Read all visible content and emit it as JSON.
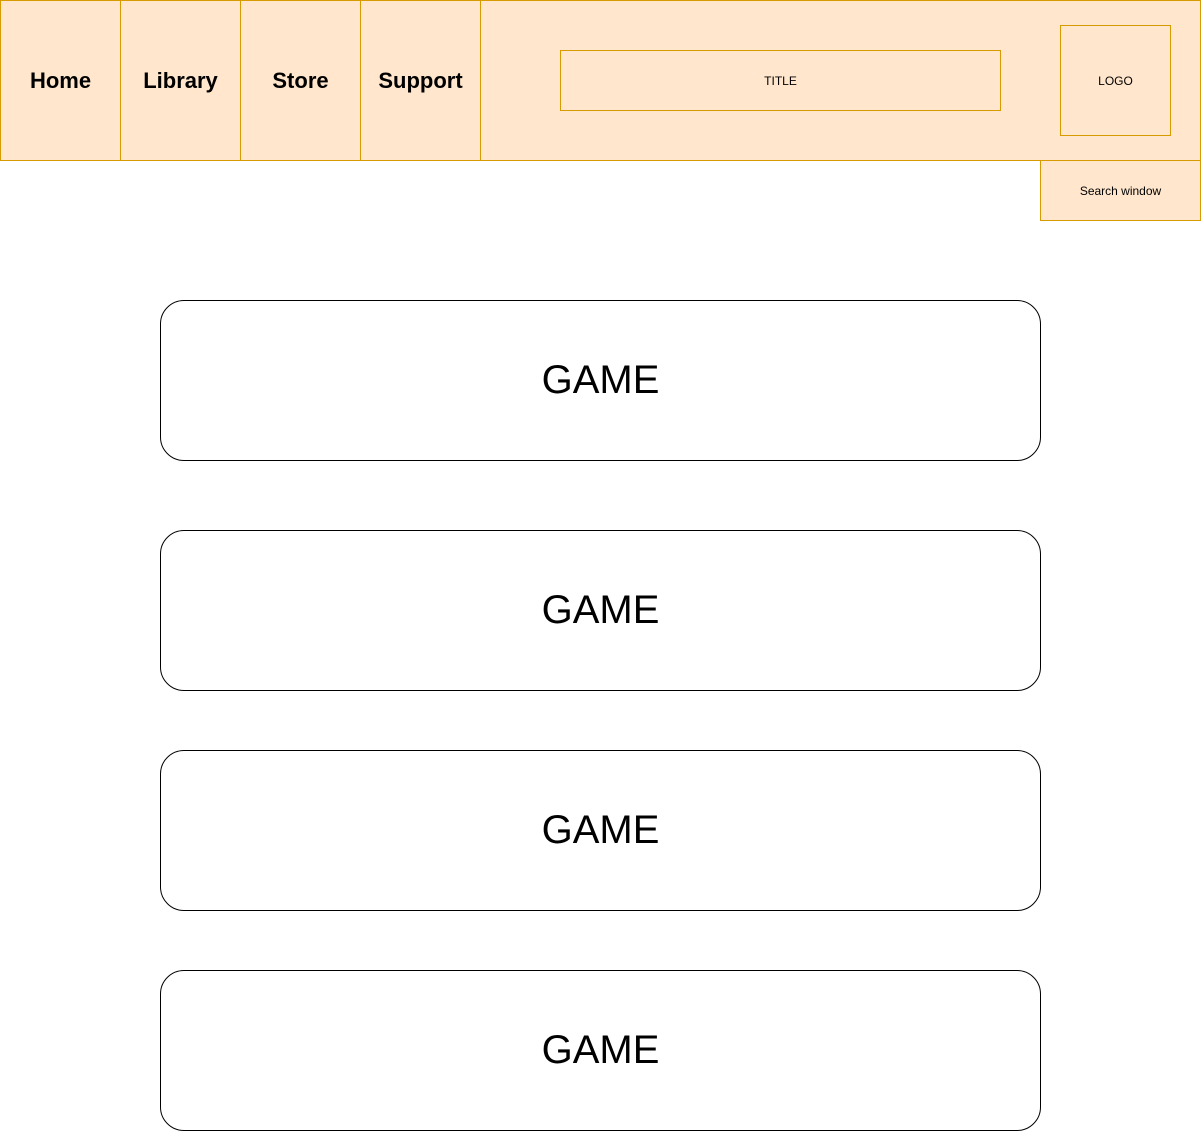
{
  "nav": {
    "items": [
      {
        "label": "Home"
      },
      {
        "label": "Library"
      },
      {
        "label": "Store"
      },
      {
        "label": "Support"
      }
    ]
  },
  "header": {
    "title": "TITLE",
    "logo": "LOGO",
    "search": "Search window"
  },
  "games": [
    {
      "label": "GAME"
    },
    {
      "label": "GAME"
    },
    {
      "label": "GAME"
    },
    {
      "label": "GAME"
    }
  ],
  "colors": {
    "header_fill": "#ffe6cc",
    "header_border": "#d79b00",
    "card_border": "#000000"
  }
}
